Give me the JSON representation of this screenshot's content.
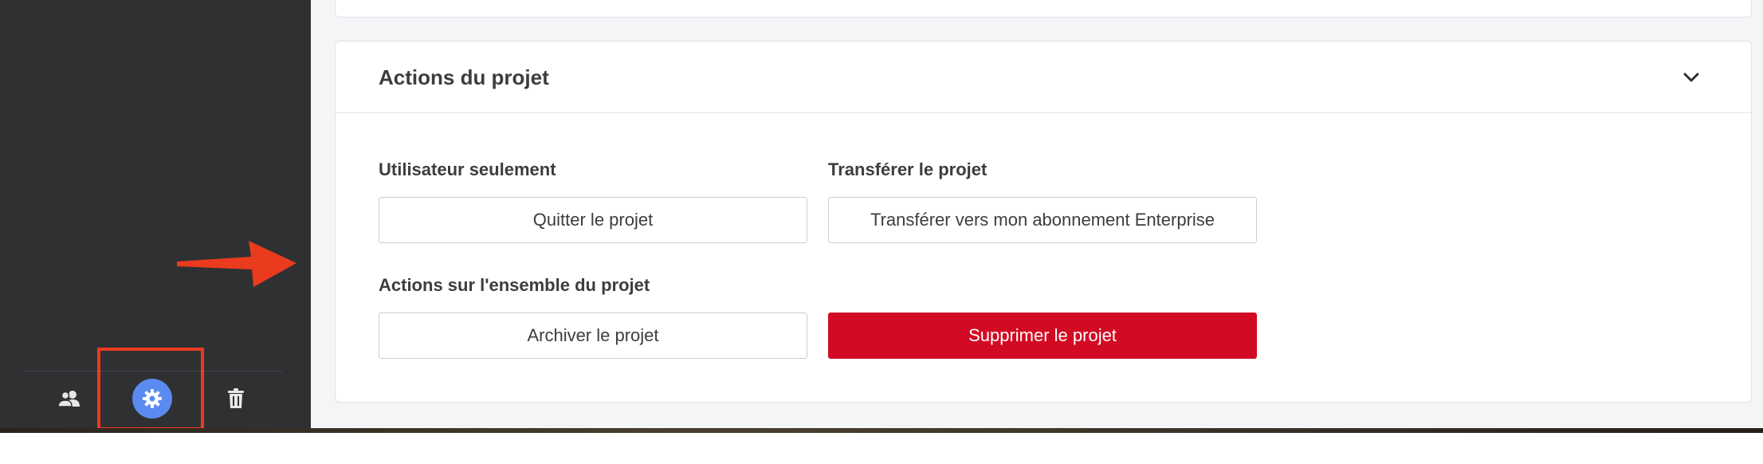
{
  "sidebar": {
    "icons": [
      "users-icon",
      "gear-icon",
      "trash-icon"
    ],
    "active_color": "#5b8af0"
  },
  "annotations": {
    "highlight_color": "#ea3b1f",
    "arrow_color": "#ea3b1f"
  },
  "card": {
    "title": "Actions du projet",
    "sections": {
      "user_only": {
        "label": "Utilisateur seulement",
        "button": "Quitter le projet"
      },
      "transfer": {
        "label": "Transférer le projet",
        "button": "Transférer vers mon abonnement Enterprise"
      },
      "project_actions": {
        "label": "Actions sur l'ensemble du projet",
        "archive_button": "Archiver le projet",
        "delete_button": "Supprimer le projet"
      }
    },
    "danger_color": "#d20a23"
  }
}
